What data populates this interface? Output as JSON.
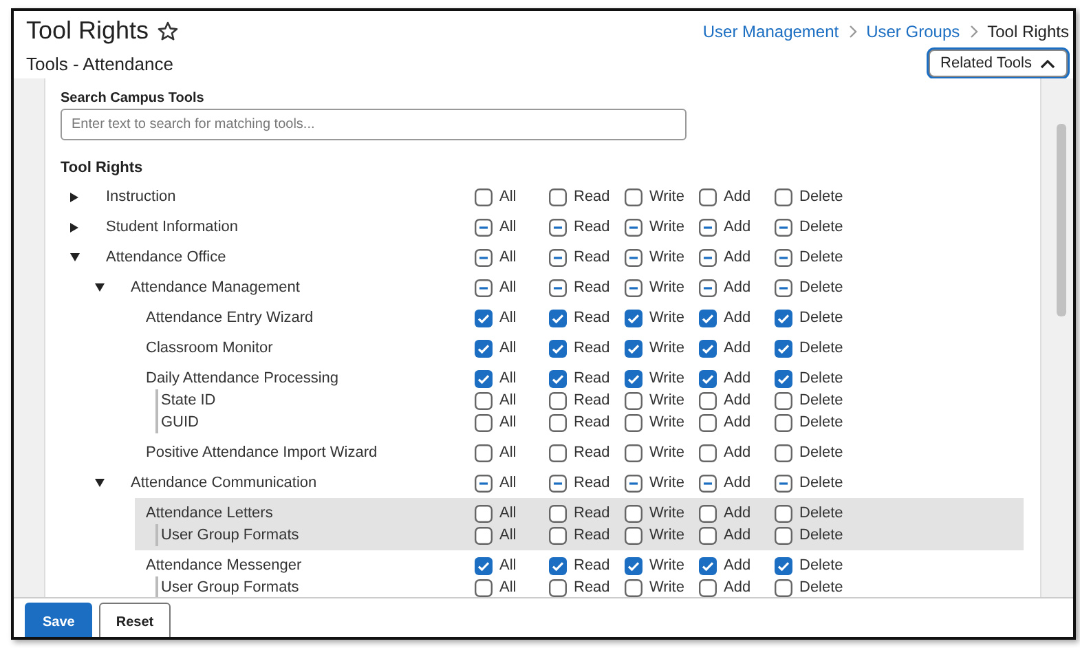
{
  "header": {
    "title": "Tool Rights",
    "subtitle": "Tools - Attendance",
    "breadcrumbs": [
      "User Management",
      "User Groups",
      "Tool Rights"
    ],
    "related_button": "Related Tools"
  },
  "search": {
    "label": "Search Campus Tools",
    "placeholder": "Enter text to search for matching tools..."
  },
  "tool_rights_heading": "Tool Rights",
  "tools": [
    {
      "kind": "folder",
      "name": "Instruction",
      "expanded": false,
      "rights": [
        {
          "label": "All",
          "checked": false,
          "mixed": false
        },
        {
          "label": "Read",
          "checked": false,
          "mixed": false
        },
        {
          "label": "Write",
          "checked": false,
          "mixed": false
        },
        {
          "label": "Add",
          "checked": false,
          "mixed": false
        },
        {
          "label": "Delete",
          "checked": false,
          "mixed": false
        }
      ]
    },
    {
      "kind": "folder",
      "name": "Student Information",
      "expanded": false,
      "rights": [
        {
          "label": "All",
          "checked": false,
          "mixed": true
        },
        {
          "label": "Read",
          "checked": false,
          "mixed": true
        },
        {
          "label": "Write",
          "checked": false,
          "mixed": true
        },
        {
          "label": "Add",
          "checked": false,
          "mixed": true
        },
        {
          "label": "Delete",
          "checked": false,
          "mixed": true
        }
      ]
    },
    {
      "kind": "folder",
      "name": "Attendance Office",
      "expanded": true,
      "rights": [
        {
          "label": "All",
          "checked": false,
          "mixed": true
        },
        {
          "label": "Read",
          "checked": false,
          "mixed": true
        },
        {
          "label": "Write",
          "checked": false,
          "mixed": true
        },
        {
          "label": "Add",
          "checked": false,
          "mixed": true
        },
        {
          "label": "Delete",
          "checked": false,
          "mixed": true
        }
      ],
      "children": [
        {
          "kind": "folder",
          "name": "Attendance Management",
          "expanded": true,
          "rights": [
            {
              "label": "All",
              "checked": false,
              "mixed": true
            },
            {
              "label": "Read",
              "checked": false,
              "mixed": true
            },
            {
              "label": "Write",
              "checked": false,
              "mixed": true
            },
            {
              "label": "Add",
              "checked": false,
              "mixed": true
            },
            {
              "label": "Delete",
              "checked": false,
              "mixed": true
            }
          ],
          "children": [
            {
              "kind": "tool",
              "name": "Attendance Entry Wizard",
              "highlighted": false,
              "rights": [
                {
                  "label": "All",
                  "checked": true,
                  "mixed": false
                },
                {
                  "label": "Read",
                  "checked": true,
                  "mixed": false
                },
                {
                  "label": "Write",
                  "checked": true,
                  "mixed": false
                },
                {
                  "label": "Add",
                  "checked": true,
                  "mixed": false
                },
                {
                  "label": "Delete",
                  "checked": true,
                  "mixed": false
                }
              ]
            },
            {
              "kind": "tool",
              "name": "Classroom Monitor",
              "highlighted": false,
              "rights": [
                {
                  "label": "All",
                  "checked": true,
                  "mixed": false
                },
                {
                  "label": "Read",
                  "checked": true,
                  "mixed": false
                },
                {
                  "label": "Write",
                  "checked": true,
                  "mixed": false
                },
                {
                  "label": "Add",
                  "checked": true,
                  "mixed": false
                },
                {
                  "label": "Delete",
                  "checked": true,
                  "mixed": false
                }
              ]
            },
            {
              "kind": "tool",
              "name": "Daily Attendance Processing",
              "highlighted": false,
              "rights": [
                {
                  "label": "All",
                  "checked": true,
                  "mixed": false
                },
                {
                  "label": "Read",
                  "checked": true,
                  "mixed": false
                },
                {
                  "label": "Write",
                  "checked": true,
                  "mixed": false
                },
                {
                  "label": "Add",
                  "checked": true,
                  "mixed": false
                },
                {
                  "label": "Delete",
                  "checked": true,
                  "mixed": false
                }
              ],
              "children": [
                {
                  "kind": "sub",
                  "name": "State ID",
                  "rights": [
                    {
                      "label": "All",
                      "checked": false,
                      "mixed": false
                    },
                    {
                      "label": "Read",
                      "checked": false,
                      "mixed": false
                    },
                    {
                      "label": "Write",
                      "checked": false,
                      "mixed": false
                    },
                    {
                      "label": "Add",
                      "checked": false,
                      "mixed": false
                    },
                    {
                      "label": "Delete",
                      "checked": false,
                      "mixed": false
                    }
                  ]
                },
                {
                  "kind": "sub",
                  "name": "GUID",
                  "rights": [
                    {
                      "label": "All",
                      "checked": false,
                      "mixed": false
                    },
                    {
                      "label": "Read",
                      "checked": false,
                      "mixed": false
                    },
                    {
                      "label": "Write",
                      "checked": false,
                      "mixed": false
                    },
                    {
                      "label": "Add",
                      "checked": false,
                      "mixed": false
                    },
                    {
                      "label": "Delete",
                      "checked": false,
                      "mixed": false
                    }
                  ]
                }
              ]
            },
            {
              "kind": "tool",
              "name": "Positive Attendance Import Wizard",
              "highlighted": false,
              "rights": [
                {
                  "label": "All",
                  "checked": false,
                  "mixed": false
                },
                {
                  "label": "Read",
                  "checked": false,
                  "mixed": false
                },
                {
                  "label": "Write",
                  "checked": false,
                  "mixed": false
                },
                {
                  "label": "Add",
                  "checked": false,
                  "mixed": false
                },
                {
                  "label": "Delete",
                  "checked": false,
                  "mixed": false
                }
              ]
            }
          ]
        },
        {
          "kind": "folder",
          "name": "Attendance Communication",
          "expanded": true,
          "rights": [
            {
              "label": "All",
              "checked": false,
              "mixed": true
            },
            {
              "label": "Read",
              "checked": false,
              "mixed": true
            },
            {
              "label": "Write",
              "checked": false,
              "mixed": true
            },
            {
              "label": "Add",
              "checked": false,
              "mixed": true
            },
            {
              "label": "Delete",
              "checked": false,
              "mixed": true
            }
          ],
          "children": [
            {
              "kind": "tool",
              "name": "Attendance Letters",
              "highlighted": true,
              "rights": [
                {
                  "label": "All",
                  "checked": false,
                  "mixed": false
                },
                {
                  "label": "Read",
                  "checked": false,
                  "mixed": false
                },
                {
                  "label": "Write",
                  "checked": false,
                  "mixed": false
                },
                {
                  "label": "Add",
                  "checked": false,
                  "mixed": false
                },
                {
                  "label": "Delete",
                  "checked": false,
                  "mixed": false
                }
              ],
              "children": [
                {
                  "kind": "sub",
                  "name": "User Group Formats",
                  "rights": [
                    {
                      "label": "All",
                      "checked": false,
                      "mixed": false
                    },
                    {
                      "label": "Read",
                      "checked": false,
                      "mixed": false
                    },
                    {
                      "label": "Write",
                      "checked": false,
                      "mixed": false
                    },
                    {
                      "label": "Add",
                      "checked": false,
                      "mixed": false
                    },
                    {
                      "label": "Delete",
                      "checked": false,
                      "mixed": false
                    }
                  ]
                }
              ]
            },
            {
              "kind": "tool",
              "name": "Attendance Messenger",
              "highlighted": false,
              "rights": [
                {
                  "label": "All",
                  "checked": true,
                  "mixed": false
                },
                {
                  "label": "Read",
                  "checked": true,
                  "mixed": false
                },
                {
                  "label": "Write",
                  "checked": true,
                  "mixed": false
                },
                {
                  "label": "Add",
                  "checked": true,
                  "mixed": false
                },
                {
                  "label": "Delete",
                  "checked": true,
                  "mixed": false
                }
              ],
              "children": [
                {
                  "kind": "sub",
                  "name": "User Group Formats",
                  "rights": [
                    {
                      "label": "All",
                      "checked": false,
                      "mixed": false
                    },
                    {
                      "label": "Read",
                      "checked": false,
                      "mixed": false
                    },
                    {
                      "label": "Write",
                      "checked": false,
                      "mixed": false
                    },
                    {
                      "label": "Add",
                      "checked": false,
                      "mixed": false
                    },
                    {
                      "label": "Delete",
                      "checked": false,
                      "mixed": false
                    }
                  ]
                }
              ]
            }
          ]
        }
      ]
    }
  ],
  "footer": {
    "buttons": [
      {
        "label": "Save",
        "kind": "primary"
      },
      {
        "label": "Reset",
        "kind": "secondary"
      }
    ]
  }
}
